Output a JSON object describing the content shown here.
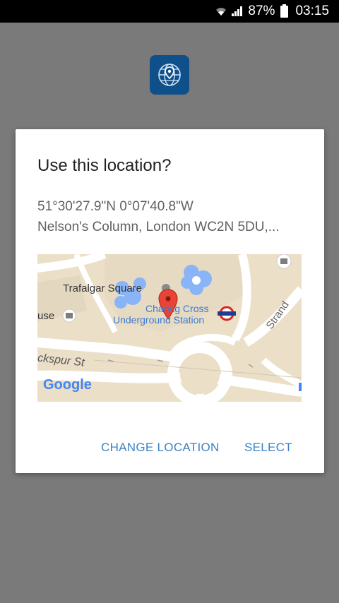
{
  "status_bar": {
    "battery_percent": "87%",
    "time": "03:15"
  },
  "dialog": {
    "title": "Use this location?",
    "coordinates": "51°30'27.9\"N 0°07'40.8\"W",
    "address": "Nelson's Column, London WC2N 5DU,..."
  },
  "map": {
    "labels": {
      "trafalgar": "Trafalgar Square",
      "charing_cross": "Charing Cross",
      "underground": "Underground Station",
      "strand": "Strand",
      "house_partial": "use",
      "cockspur": "ckspur St",
      "google": "Google"
    }
  },
  "actions": {
    "change_location": "CHANGE LOCATION",
    "select": "SELECT"
  }
}
